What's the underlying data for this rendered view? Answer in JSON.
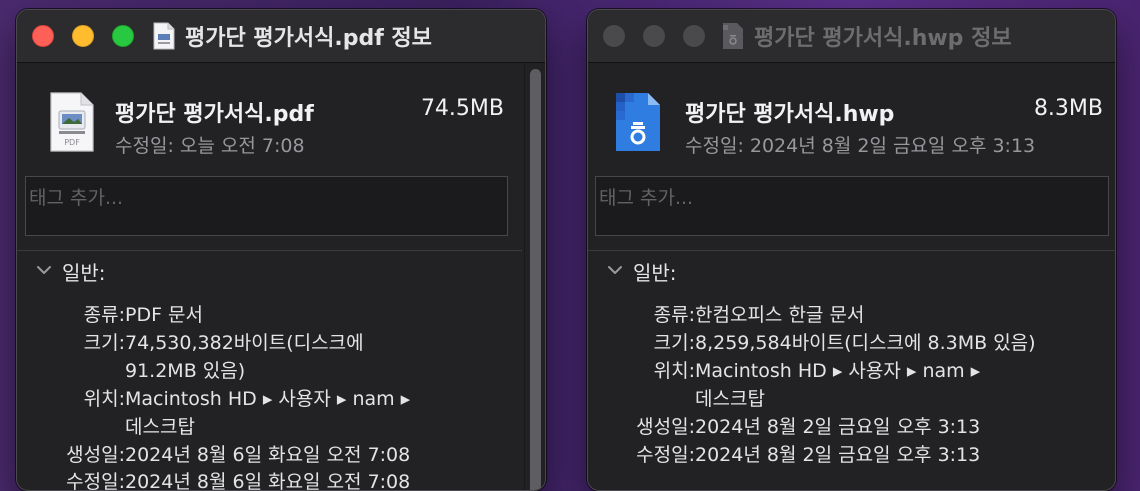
{
  "colors": {
    "accent_blue": "#2f7de1",
    "close_red": "#fe5f57",
    "minimize_yellow": "#febc2e",
    "zoom_green": "#28c840"
  },
  "window1": {
    "title": "평가단 평가서식.pdf 정보",
    "title_icon": "pdf-document-icon",
    "file_icon": "pdf-file-icon",
    "file_icon_label": "PDF",
    "file_name": "평가단 평가서식.pdf",
    "file_size": "74.5MB",
    "modified_line": "수정일: 오늘 오전 7:08",
    "tag_placeholder": "태그 추가...",
    "section_general": "일반:",
    "rows": {
      "kind": {
        "label": "종류:",
        "value": "PDF 문서"
      },
      "size": {
        "label": "크기:",
        "value": "74,530,382바이트(디스크에",
        "value2": "91.2MB 있음)"
      },
      "where": {
        "label": "위치:",
        "value": "Macintosh HD ▸ 사용자 ▸ nam ▸",
        "value2": "데스크탑"
      },
      "created": {
        "label": "생성일:",
        "value": "2024년 8월 6일 화요일 오전 7:08"
      },
      "modified": {
        "label": "수정일:",
        "value": "2024년 8월 6일 화요일 오전 7:08"
      }
    }
  },
  "window2": {
    "title": "평가단 평가서식.hwp 정보",
    "title_icon": "hwp-document-icon",
    "file_icon": "hwp-file-icon",
    "file_name": "평가단 평가서식.hwp",
    "file_size": "8.3MB",
    "modified_line": "수정일: 2024년 8월 2일 금요일 오후 3:13",
    "tag_placeholder": "태그 추가...",
    "section_general": "일반:",
    "rows": {
      "kind": {
        "label": "종류:",
        "value": "한컴오피스 한글 문서"
      },
      "size": {
        "label": "크기:",
        "value": "8,259,584바이트(디스크에 8.3MB 있음)"
      },
      "where": {
        "label": "위치:",
        "value": "Macintosh HD ▸ 사용자 ▸ nam ▸",
        "value2": "데스크탑"
      },
      "created": {
        "label": "생성일:",
        "value": "2024년 8월 2일 금요일 오후 3:13"
      },
      "modified": {
        "label": "수정일:",
        "value": "2024년 8월 2일 금요일 오후 3:13"
      }
    }
  }
}
